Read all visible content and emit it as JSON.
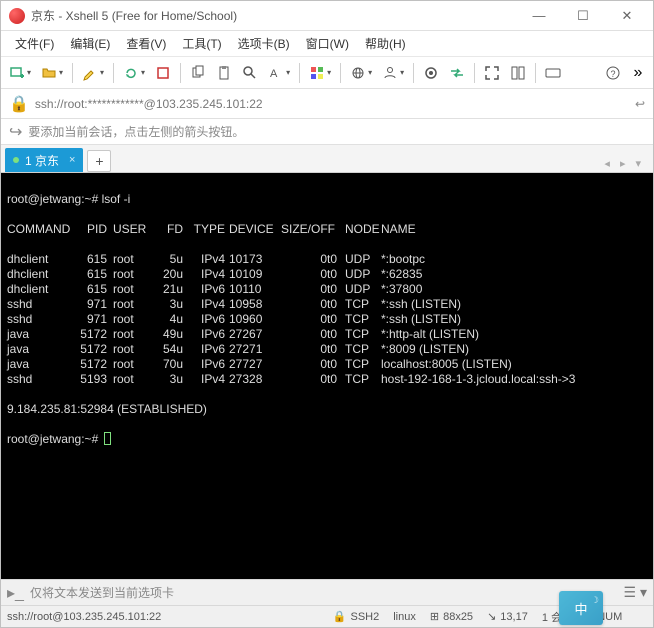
{
  "titlebar": {
    "title": "京东 - Xshell 5 (Free for Home/School)"
  },
  "menubar": {
    "items": [
      "文件(F)",
      "编辑(E)",
      "查看(V)",
      "工具(T)",
      "选项卡(B)",
      "窗口(W)",
      "帮助(H)"
    ]
  },
  "addressbar": {
    "url": "ssh://root:************@103.235.245.101:22"
  },
  "hintbar": {
    "text": "要添加当前会话，点击左侧的箭头按钮。"
  },
  "tabs": {
    "active": {
      "label": "1 京东"
    }
  },
  "terminal": {
    "prompt1": "root@jetwang:~# ",
    "cmd1": "lsof -i",
    "header": {
      "command": "COMMAND",
      "pid": "PID",
      "user": "USER",
      "fd": "FD",
      "type": "TYPE",
      "device": "DEVICE",
      "sizeoff": "SIZE/OFF",
      "node": "NODE",
      "name": "NAME"
    },
    "rows": [
      {
        "command": "dhclient",
        "pid": "615",
        "user": "root",
        "fd": "5u",
        "type": "IPv4",
        "device": "10173",
        "sizeoff": "0t0",
        "node": "UDP",
        "name": "*:bootpc"
      },
      {
        "command": "dhclient",
        "pid": "615",
        "user": "root",
        "fd": "20u",
        "type": "IPv4",
        "device": "10109",
        "sizeoff": "0t0",
        "node": "UDP",
        "name": "*:62835"
      },
      {
        "command": "dhclient",
        "pid": "615",
        "user": "root",
        "fd": "21u",
        "type": "IPv6",
        "device": "10110",
        "sizeoff": "0t0",
        "node": "UDP",
        "name": "*:37800"
      },
      {
        "command": "sshd",
        "pid": "971",
        "user": "root",
        "fd": "3u",
        "type": "IPv4",
        "device": "10958",
        "sizeoff": "0t0",
        "node": "TCP",
        "name": "*:ssh (LISTEN)"
      },
      {
        "command": "sshd",
        "pid": "971",
        "user": "root",
        "fd": "4u",
        "type": "IPv6",
        "device": "10960",
        "sizeoff": "0t0",
        "node": "TCP",
        "name": "*:ssh (LISTEN)"
      },
      {
        "command": "java",
        "pid": "5172",
        "user": "root",
        "fd": "49u",
        "type": "IPv6",
        "device": "27267",
        "sizeoff": "0t0",
        "node": "TCP",
        "name": "*:http-alt (LISTEN)"
      },
      {
        "command": "java",
        "pid": "5172",
        "user": "root",
        "fd": "54u",
        "type": "IPv6",
        "device": "27271",
        "sizeoff": "0t0",
        "node": "TCP",
        "name": "*:8009 (LISTEN)"
      },
      {
        "command": "java",
        "pid": "5172",
        "user": "root",
        "fd": "70u",
        "type": "IPv6",
        "device": "27727",
        "sizeoff": "0t0",
        "node": "TCP",
        "name": "localhost:8005 (LISTEN)"
      },
      {
        "command": "sshd",
        "pid": "5193",
        "user": "root",
        "fd": "3u",
        "type": "IPv4",
        "device": "27328",
        "sizeoff": "0t0",
        "node": "TCP",
        "name": "host-192-168-1-3.jcloud.local:ssh->3"
      }
    ],
    "wrap_line": "9.184.235.81:52984 (ESTABLISHED)",
    "prompt2": "root@jetwang:~# "
  },
  "sendbar": {
    "text": "仅将文本发送到当前选项卡"
  },
  "statusbar": {
    "conn": "ssh://root@103.235.245.101:22",
    "proto": "SSH2",
    "os": "linux",
    "size": "88x25",
    "cursor": "13,17",
    "sessions": "1 会话",
    "ime": "中",
    "caps": "P NUM"
  }
}
